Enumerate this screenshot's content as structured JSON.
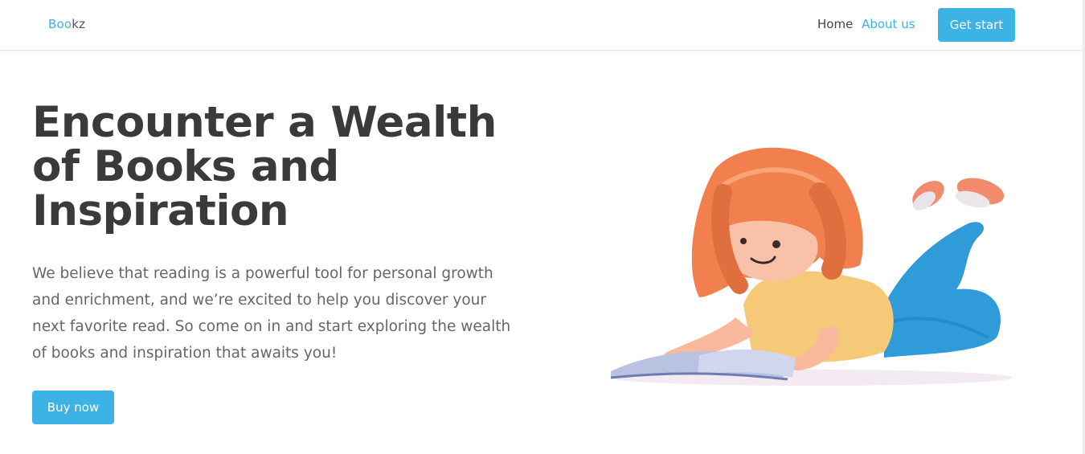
{
  "navbar": {
    "logo_part1": "Boo",
    "logo_part2": "kz",
    "links": [
      {
        "label": "Home",
        "active": false
      },
      {
        "label": "About us",
        "active": true
      }
    ],
    "cta_label": "Get start"
  },
  "hero": {
    "title": "Encounter a Wealth of Books and Inspiration",
    "description": "We believe that reading is a powerful tool for personal growth and enrichment, and we’re excited to help you discover your next favorite read. So come on in and start exploring the wealth of books and inspiration that awaits you!",
    "button_label": "Buy now"
  },
  "illustration": {
    "icon": "girl-reading-book-illustration"
  },
  "colors": {
    "accent": "#3db2e4",
    "heading": "#3a3a3a",
    "body_text": "#666666"
  }
}
